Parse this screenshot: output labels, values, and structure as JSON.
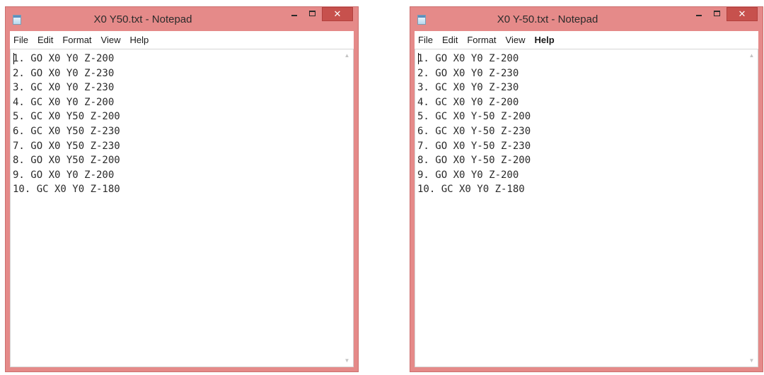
{
  "windows": [
    {
      "title": "X0 Y50.txt - Notepad",
      "menu": [
        "File",
        "Edit",
        "Format",
        "View",
        "Help"
      ],
      "lines": [
        "1. GO X0 Y0 Z-200",
        "2. GO X0 Y0 Z-230",
        "3. GC X0 Y0 Z-230",
        "4. GC X0 Y0 Z-200",
        "5. GC X0 Y50 Z-200",
        "6. GC X0 Y50 Z-230",
        "7. GO X0 Y50 Z-230",
        "8. GO X0 Y50 Z-200",
        "9. GO X0 Y0 Z-200",
        "10. GC X0 Y0 Z-180"
      ],
      "buttons": {
        "minimize": "",
        "maximize": "",
        "close": "✕"
      },
      "scroll": {
        "up": "▲",
        "down": "▼"
      }
    },
    {
      "title": "X0 Y-50.txt - Notepad",
      "menu": [
        "File",
        "Edit",
        "Format",
        "View",
        "Help"
      ],
      "lines": [
        "1. GO X0 Y0 Z-200",
        "2. GO X0 Y0 Z-230",
        "3. GC X0 Y0 Z-230",
        "4. GC X0 Y0 Z-200",
        "5. GC X0 Y-50 Z-200",
        "6. GC X0 Y-50 Z-230",
        "7. GO X0 Y-50 Z-230",
        "8. GO X0 Y-50 Z-200",
        "9. GO X0 Y0 Z-200",
        "10. GC X0 Y0 Z-180"
      ],
      "buttons": {
        "minimize": "",
        "maximize": "",
        "close": "✕"
      },
      "scroll": {
        "up": "▲",
        "down": "▼"
      }
    }
  ]
}
